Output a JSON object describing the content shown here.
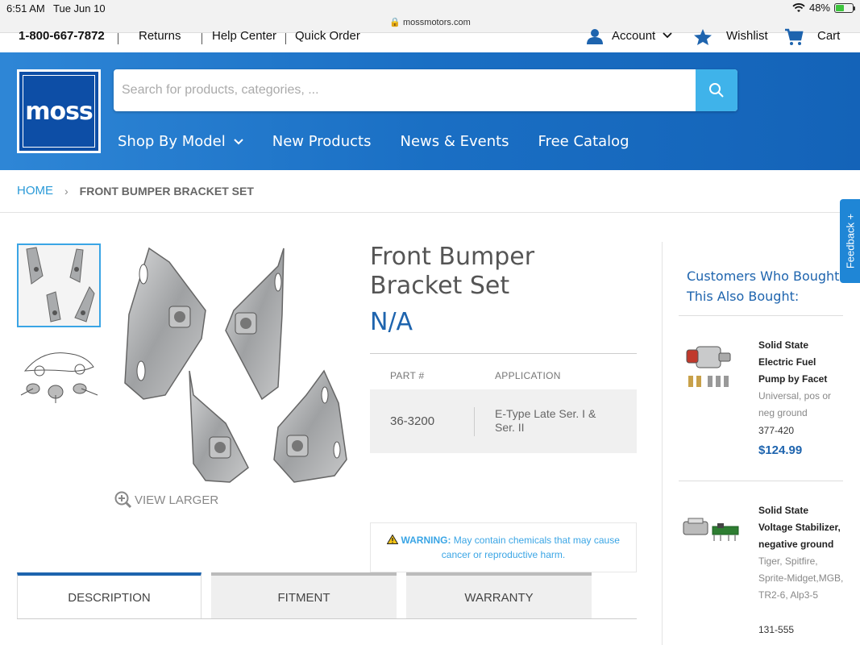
{
  "status_bar": {
    "time": "6:51 AM",
    "date": "Tue Jun 10",
    "url": "mossmotors.com",
    "battery": "48%",
    "battery_level": 0.48
  },
  "utility_bar": {
    "phone": "1-800-667-7872",
    "returns": "Returns",
    "help_center": "Help Center",
    "quick_order": "Quick Order",
    "account": "Account",
    "wishlist": "Wishlist",
    "cart": "Cart"
  },
  "header": {
    "logo_text": "moss",
    "search_placeholder": "Search for products, categories, ...",
    "nav": {
      "shop_by_model": "Shop By Model",
      "new_products": "New Products",
      "news_events": "News & Events",
      "free_catalog": "Free Catalog"
    }
  },
  "breadcrumb": {
    "home": "HOME",
    "separator": "›",
    "current": "FRONT BUMPER BRACKET SET"
  },
  "gallery": {
    "view_larger": "VIEW LARGER"
  },
  "product": {
    "title": "Front Bumper Bracket Set",
    "price": "N/A",
    "table": {
      "headers": [
        "PART #",
        "APPLICATION"
      ],
      "rows": [
        {
          "part": "36-3200",
          "application": "E-Type Late Ser. I & Ser. II"
        }
      ]
    },
    "warning": {
      "label": "WARNING:",
      "text_line1": "May contain chemicals that may cause",
      "text_line2": "cancer or reproductive harm."
    }
  },
  "tabs": [
    "DESCRIPTION",
    "FITMENT",
    "WARRANTY"
  ],
  "sidebar": {
    "title": "Customers Who Bought This Also Bought:",
    "items": [
      {
        "name": "Solid State Electric Fuel Pump by Facet",
        "description": "Universal, pos or neg ground",
        "sku": "377-420",
        "price": "$124.99"
      },
      {
        "name": "Solid State Voltage Stabilizer, negative ground",
        "description": "Tiger, Spitfire, Sprite-Midget,MGB, TR2-6, Alp3-5",
        "sku": "131-555"
      }
    ]
  },
  "feedback": "Feedback +",
  "colors": {
    "header_blue": "#1a6fc4",
    "logo_blue": "#0d4ea6",
    "link_blue": "#2a9ad8",
    "price_blue": "#1e64ae",
    "search_button": "#3fb3ea"
  }
}
